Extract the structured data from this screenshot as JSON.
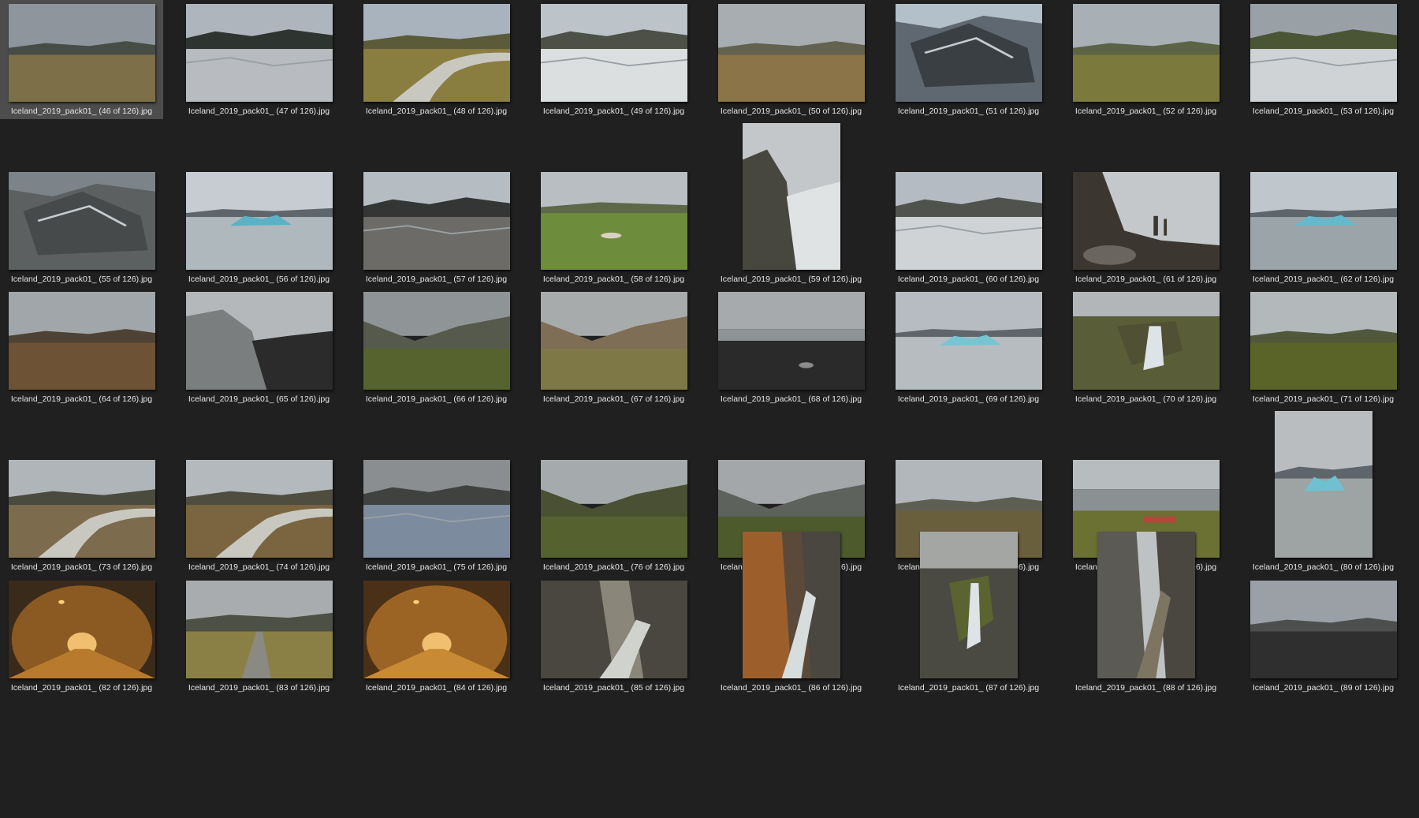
{
  "files": [
    {
      "name": "Iceland_2019_pack01_ (46 of 126).jpg",
      "selected": true,
      "orientation": "landscape",
      "scene": "plain",
      "colors": {
        "sky": "#8f959c",
        "mid": "#474c45",
        "ground": "#7d6f48"
      }
    },
    {
      "name": "Iceland_2019_pack01_ (47 of 126).jpg",
      "orientation": "landscape",
      "scene": "glacier",
      "colors": {
        "sky": "#aeb5bc",
        "mid": "#2e3430",
        "ground": "#b8bcc0"
      }
    },
    {
      "name": "Iceland_2019_pack01_ (48 of 126).jpg",
      "orientation": "landscape",
      "scene": "river",
      "colors": {
        "sky": "#a8b3bd",
        "mid": "#5b5a39",
        "ground": "#8a7d40"
      }
    },
    {
      "name": "Iceland_2019_pack01_ (49 of 126).jpg",
      "orientation": "landscape",
      "scene": "glacier",
      "colors": {
        "sky": "#bcc3c9",
        "mid": "#4c5046",
        "ground": "#dcdfe0"
      }
    },
    {
      "name": "Iceland_2019_pack01_ (50 of 126).jpg",
      "orientation": "landscape",
      "scene": "plain",
      "colors": {
        "sky": "#a7adb1",
        "mid": "#63624f",
        "ground": "#8b7448"
      }
    },
    {
      "name": "Iceland_2019_pack01_ (51 of 126).jpg",
      "orientation": "landscape",
      "scene": "ice",
      "colors": {
        "sky": "#b4c0c9",
        "mid": "#3a3f44",
        "ground": "#5f6870"
      }
    },
    {
      "name": "Iceland_2019_pack01_ (52 of 126).jpg",
      "orientation": "landscape",
      "scene": "plain",
      "colors": {
        "sky": "#a9b0b5",
        "mid": "#5d6445",
        "ground": "#7b7a3c"
      }
    },
    {
      "name": "Iceland_2019_pack01_ (53 of 126).jpg",
      "orientation": "landscape",
      "scene": "glacier",
      "colors": {
        "sky": "#9aa1a6",
        "mid": "#4a5536",
        "ground": "#cfd3d6"
      }
    },
    {
      "name": "Iceland_2019_pack01_ (55 of 126).jpg",
      "orientation": "landscape",
      "scene": "ice",
      "colors": {
        "sky": "#7d8489",
        "mid": "#474a4b",
        "ground": "#5c6061"
      }
    },
    {
      "name": "Iceland_2019_pack01_ (56 of 126).jpg",
      "orientation": "landscape",
      "scene": "iceberg",
      "colors": {
        "sky": "#c6ccd1",
        "mid": "#5cb1c4",
        "ground": "#aeb8bd"
      }
    },
    {
      "name": "Iceland_2019_pack01_ (57 of 126).jpg",
      "orientation": "landscape",
      "scene": "glacier",
      "colors": {
        "sky": "#b5bcc2",
        "mid": "#343636",
        "ground": "#6c6b68"
      }
    },
    {
      "name": "Iceland_2019_pack01_ (58 of 126).jpg",
      "orientation": "landscape",
      "scene": "field",
      "colors": {
        "sky": "#b9bec3",
        "mid": "#5d6848",
        "ground": "#6d8c3c"
      }
    },
    {
      "name": "Iceland_2019_pack01_ (59 of 126).jpg",
      "orientation": "portrait",
      "scene": "coast",
      "colors": {
        "sky": "#c4c7c9",
        "mid": "#47463f",
        "ground": "#e0e3e4"
      }
    },
    {
      "name": "Iceland_2019_pack01_ (60 of 126).jpg",
      "orientation": "landscape",
      "scene": "glacier",
      "colors": {
        "sky": "#b4bbc2",
        "mid": "#50534d",
        "ground": "#d0d3d6"
      }
    },
    {
      "name": "Iceland_2019_pack01_ (61 of 126).jpg",
      "orientation": "landscape",
      "scene": "rocks",
      "colors": {
        "sky": "#c5c8ca",
        "mid": "#3b3630",
        "ground": "#6b6560"
      }
    },
    {
      "name": "Iceland_2019_pack01_ (62 of 126).jpg",
      "orientation": "landscape",
      "scene": "iceberg",
      "colors": {
        "sky": "#bfc6cc",
        "mid": "#65b9cb",
        "ground": "#9aa4a9"
      }
    },
    {
      "name": "Iceland_2019_pack01_ (64 of 126).jpg",
      "orientation": "landscape",
      "scene": "plain",
      "colors": {
        "sky": "#a1a6aa",
        "mid": "#4d4234",
        "ground": "#6e5235"
      }
    },
    {
      "name": "Iceland_2019_pack01_ (65 of 126).jpg",
      "orientation": "landscape",
      "scene": "coast",
      "colors": {
        "sky": "#b5b8ba",
        "mid": "#7b7e7f",
        "ground": "#2b2b2b"
      }
    },
    {
      "name": "Iceland_2019_pack01_ (66 of 126).jpg",
      "orientation": "landscape",
      "scene": "valley",
      "colors": {
        "sky": "#8f9496",
        "mid": "#555a4d",
        "ground": "#56632e"
      }
    },
    {
      "name": "Iceland_2019_pack01_ (67 of 126).jpg",
      "orientation": "landscape",
      "scene": "valley",
      "colors": {
        "sky": "#a8abac",
        "mid": "#7d6e55",
        "ground": "#7e7847"
      }
    },
    {
      "name": "Iceland_2019_pack01_ (68 of 126).jpg",
      "orientation": "landscape",
      "scene": "beach",
      "colors": {
        "sky": "#a6aaad",
        "mid": "#3f4141",
        "ground": "#2a2a2a"
      }
    },
    {
      "name": "Iceland_2019_pack01_ (69 of 126).jpg",
      "orientation": "landscape",
      "scene": "iceberg",
      "colors": {
        "sky": "#b6bcc2",
        "mid": "#77c4d2",
        "ground": "#b6bcbf"
      }
    },
    {
      "name": "Iceland_2019_pack01_ (70 of 126).jpg",
      "orientation": "landscape",
      "scene": "waterfall",
      "colors": {
        "sky": "#b2b6b8",
        "mid": "#4f5034",
        "ground": "#5a5e38"
      }
    },
    {
      "name": "Iceland_2019_pack01_ (71 of 126).jpg",
      "orientation": "landscape",
      "scene": "plain",
      "colors": {
        "sky": "#b3b8bb",
        "mid": "#51573a",
        "ground": "#5b6428"
      }
    },
    {
      "name": "Iceland_2019_pack01_ (73 of 126).jpg",
      "orientation": "landscape",
      "scene": "river",
      "colors": {
        "sky": "#b0b5b9",
        "mid": "#4a4a3f",
        "ground": "#7d6b4e"
      }
    },
    {
      "name": "Iceland_2019_pack01_ (74 of 126).jpg",
      "orientation": "landscape",
      "scene": "river",
      "colors": {
        "sky": "#b4b9bd",
        "mid": "#4f4d40",
        "ground": "#7a6540"
      }
    },
    {
      "name": "Iceland_2019_pack01_ (75 of 126).jpg",
      "orientation": "landscape",
      "scene": "glacier",
      "colors": {
        "sky": "#8b8e90",
        "mid": "#3f423f",
        "ground": "#7d8b9f"
      }
    },
    {
      "name": "Iceland_2019_pack01_ (76 of 126).jpg",
      "orientation": "landscape",
      "scene": "valley",
      "colors": {
        "sky": "#a5aaad",
        "mid": "#4a5033",
        "ground": "#55612e"
      }
    },
    {
      "name": "Iceland_2019_pack01_ (77 of 126).jpg",
      "orientation": "landscape",
      "scene": "valley",
      "colors": {
        "sky": "#a3a7a9",
        "mid": "#5e625c",
        "ground": "#4d5a2c"
      }
    },
    {
      "name": "Iceland_2019_pack01_ (78 of 126).jpg",
      "orientation": "landscape",
      "scene": "plain",
      "colors": {
        "sky": "#b2b7bb",
        "mid": "#5d5f53",
        "ground": "#6a5f3c"
      }
    },
    {
      "name": "Iceland_2019_pack01_ (79 of 126).jpg",
      "orientation": "landscape",
      "scene": "lake",
      "colors": {
        "sky": "#b7bcbf",
        "mid": "#8b9092",
        "ground": "#6a7133"
      }
    },
    {
      "name": "Iceland_2019_pack01_ (80 of 126).jpg",
      "orientation": "portrait",
      "scene": "iceberg",
      "colors": {
        "sky": "#b9bdc0",
        "mid": "#6fc0d0",
        "ground": "#9ea3a4"
      }
    },
    {
      "name": "Iceland_2019_pack01_ (82 of 126).jpg",
      "orientation": "landscape",
      "scene": "tunnel",
      "colors": {
        "sky": "#3a2a1a",
        "mid": "#8a5a22",
        "ground": "#b87a2d"
      }
    },
    {
      "name": "Iceland_2019_pack01_ (83 of 126).jpg",
      "orientation": "landscape",
      "scene": "road",
      "colors": {
        "sky": "#a8acae",
        "mid": "#4d5044",
        "ground": "#8a8045"
      }
    },
    {
      "name": "Iceland_2019_pack01_ (84 of 126).jpg",
      "orientation": "landscape",
      "scene": "tunnel",
      "colors": {
        "sky": "#4a3016",
        "mid": "#9c6424",
        "ground": "#c88a34"
      }
    },
    {
      "name": "Iceland_2019_pack01_ (85 of 126).jpg",
      "orientation": "landscape",
      "scene": "canyon",
      "colors": {
        "sky": "#8a8679",
        "mid": "#4a4640",
        "ground": "#cfd2cd"
      }
    },
    {
      "name": "Iceland_2019_pack01_ (86 of 126).jpg",
      "orientation": "portrait",
      "scene": "canyon",
      "colors": {
        "sky": "#5b4a3a",
        "mid": "#9c5f2c",
        "ground": "#d7dcdc"
      }
    },
    {
      "name": "Iceland_2019_pack01_ (87 of 126).jpg",
      "orientation": "portrait",
      "scene": "waterfall",
      "colors": {
        "sky": "#a4a6a4",
        "mid": "#5b6431",
        "ground": "#4a4a42"
      }
    },
    {
      "name": "Iceland_2019_pack01_ (88 of 126).jpg",
      "orientation": "portrait",
      "scene": "canyon",
      "colors": {
        "sky": "#bfc2c3",
        "mid": "#5b5a55",
        "ground": "#7d7562"
      }
    },
    {
      "name": "Iceland_2019_pack01_ (89 of 126).jpg",
      "orientation": "landscape",
      "scene": "plain",
      "colors": {
        "sky": "#9aa0a6",
        "mid": "#4d4f4f",
        "ground": "#2f2f2f"
      }
    }
  ]
}
